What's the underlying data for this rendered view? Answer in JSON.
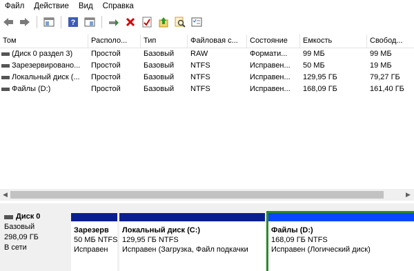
{
  "menu": [
    "Файл",
    "Действие",
    "Вид",
    "Справка"
  ],
  "toolbar": {
    "icons": [
      "back-icon",
      "forward-icon",
      "console-tree-icon",
      "help-icon",
      "connect-disk-icon",
      "delete-icon",
      "check-icon",
      "up-arrow-icon",
      "search-icon",
      "properties-icon"
    ],
    "colors": {
      "delete": "#d40000",
      "help": "#3d5cb5",
      "accent": "#e0b020"
    }
  },
  "table": {
    "columns": [
      "Том",
      "Располо...",
      "Тип",
      "Файловая с...",
      "Состояние",
      "Емкость",
      "Свобод..."
    ],
    "rows": [
      [
        "(Диск 0 раздел 3)",
        "Простой",
        "Базовый",
        "RAW",
        "Формати...",
        "99 МБ",
        "99 МБ"
      ],
      [
        "Зарезервировано...",
        "Простой",
        "Базовый",
        "NTFS",
        "Исправен...",
        "50 МБ",
        "19 МБ"
      ],
      [
        "Локальный диск (...",
        "Простой",
        "Базовый",
        "NTFS",
        "Исправен...",
        "129,95 ГБ",
        "79,27 ГБ"
      ],
      [
        "Файлы (D:)",
        "Простой",
        "Базовый",
        "NTFS",
        "Исправен...",
        "168,09 ГБ",
        "161,40 ГБ"
      ]
    ]
  },
  "disk": {
    "name": "Диск 0",
    "type": "Базовый",
    "size": "298,09 ГБ",
    "status": "В сети",
    "partitions": [
      {
        "name": "Зарезерв",
        "size": "50 МБ NTFS",
        "status": "Исправен"
      },
      {
        "name": "Локальный диск (C:)",
        "size": "129,95 ГБ NTFS",
        "status": "Исправен (Загрузка, Файл подкачки"
      },
      {
        "name": "Файлы (D:)",
        "size": "168,09 ГБ NTFS",
        "status": "Исправен (Логический диск)"
      }
    ],
    "colors": {
      "primary_bar": "#0a1f8f",
      "logical_bar": "#0a46ff",
      "logical_border": "#2a8a2a"
    }
  }
}
